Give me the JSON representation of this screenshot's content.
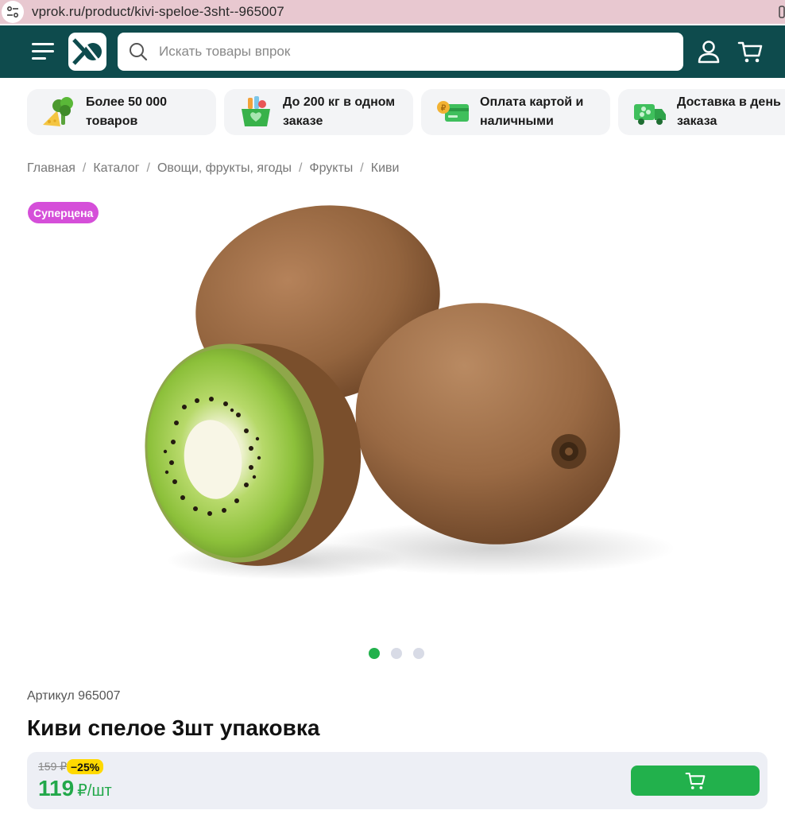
{
  "browser": {
    "url": "vprok.ru/product/kivi-speloe-3sht--965007"
  },
  "header": {
    "search_placeholder": "Искать товары впрок",
    "icons": [
      "menu-icon",
      "logo",
      "search-icon",
      "user-icon",
      "cart-icon"
    ]
  },
  "features": [
    {
      "label": "Более 50 000 товаров",
      "icon": "broccoli-cheese-icon"
    },
    {
      "label": "До 200 кг в одном заказе",
      "icon": "grocery-box-icon"
    },
    {
      "label": "Оплата картой и наличными",
      "icon": "card-coin-icon"
    },
    {
      "label": "Доставка в день заказа",
      "icon": "delivery-truck-icon"
    }
  ],
  "breadcrumb": [
    "Главная",
    "Каталог",
    "Овощи, фрукты, ягоды",
    "Фрукты",
    "Киви"
  ],
  "badge": "Суперцена",
  "gallery": {
    "slides": 3,
    "active": 1
  },
  "product": {
    "article": "Артикул 965007",
    "title": "Киви спелое 3шт упаковка",
    "old_price": "159 ₽",
    "discount": "−25%",
    "price": "119",
    "price_unit": "₽/шт"
  },
  "colors": {
    "header_bg": "#0e4b4d",
    "accent_green": "#22b14c",
    "badge_pink": "#d54fd9",
    "discount_yellow": "#ffd900",
    "urlbar_bg": "#e8c8d0"
  }
}
